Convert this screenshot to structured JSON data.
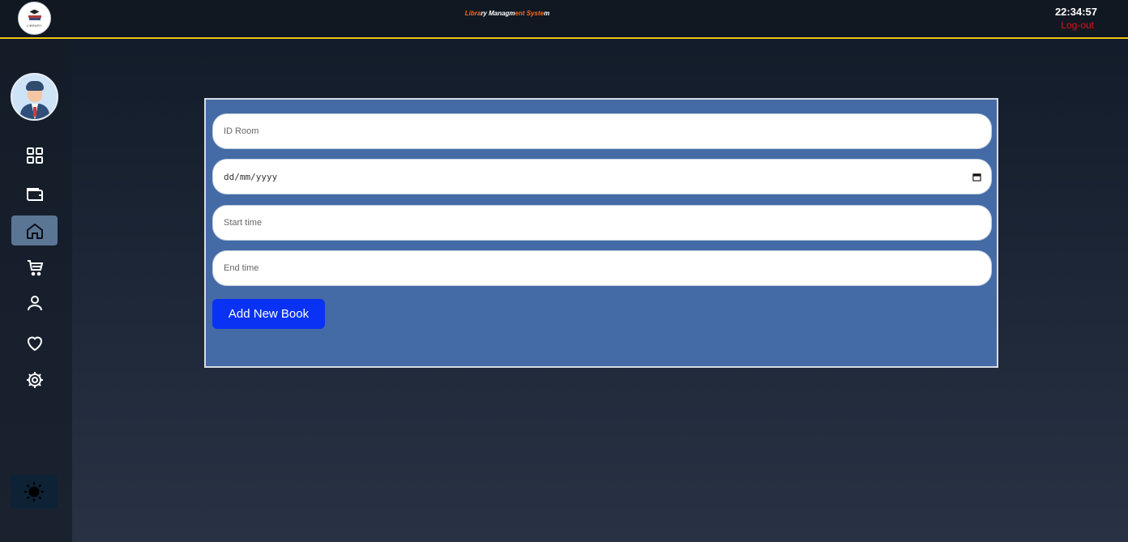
{
  "header": {
    "logo_text": "LIBRARY",
    "title_parts": [
      {
        "text": "Libra",
        "color": "#ff6a1a"
      },
      {
        "text": "ry Managm",
        "color": "#ffffff"
      },
      {
        "text": "ent Syste",
        "color": "#ff6a1a"
      },
      {
        "text": "m",
        "color": "#ffffff"
      }
    ],
    "clock": "22:34:57",
    "logout_label": "Log-out"
  },
  "sidebar": {
    "items": [
      {
        "icon": "dashboard-icon",
        "active": false
      },
      {
        "icon": "wallet-icon",
        "active": false
      },
      {
        "icon": "home-icon",
        "active": true
      },
      {
        "icon": "cart-icon",
        "active": false
      },
      {
        "icon": "user-icon",
        "active": false
      },
      {
        "icon": "heart-icon",
        "active": false
      },
      {
        "icon": "gear-icon",
        "active": false
      }
    ],
    "theme_toggle_icon": "sun-icon"
  },
  "form": {
    "id_room_placeholder": "ID Room",
    "date_placeholder": "dd/mm/yyyy",
    "start_time_placeholder": "Start time",
    "end_time_placeholder": "End time",
    "submit_label": "Add New Book"
  },
  "colors": {
    "accent_line": "#f0c419",
    "panel": "#456ba6",
    "button": "#0a32f5",
    "logout": "#e0141b",
    "title_orange": "#ff6a1a"
  }
}
